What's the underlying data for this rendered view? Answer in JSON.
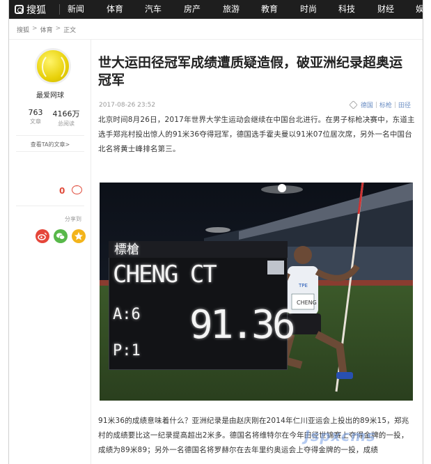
{
  "header": {
    "logo_text": "搜狐",
    "nav": [
      "新闻",
      "体育",
      "汽车",
      "房产",
      "旅游",
      "教育",
      "时尚",
      "科技",
      "财经",
      "娱"
    ]
  },
  "breadcrumb": [
    "搜狐",
    "体育",
    "正文"
  ],
  "author": {
    "name": "最爱网球",
    "articles": "763",
    "articles_label": "文章",
    "reads": "4166万",
    "reads_label": "总阅读",
    "view_link": "查看TA的文章>"
  },
  "engagement": {
    "comment_count": "0",
    "share_label": "分享到"
  },
  "article": {
    "title": "世大运田径冠军成绩遭质疑造假，破亚洲纪录超奥运冠军",
    "date": "2017-08-26 23:52",
    "tags": [
      "德国",
      "标枪",
      "田径"
    ],
    "para1": "北京时间8月26日，2017年世界大学生运动会继续在中国台北进行。在男子标枪决赛中，东道主选手郑兆村投出惊人的91米36夺得冠军，德国选手霍夫曼以91米07位居次席，另外一名中国台北名将黄士峰排名第三。",
    "para2": "91米36的成绩意味着什么？亚洲纪录是由赵庆刚在2014年仁川亚运会上投出的89米15，郑兆村的成绩要比这一纪录提高超出2米多。德国名将维特尔在今年田径世锦赛上夺得金牌的一投，成绩为89米89；另外一名德国名将罗赫尔在去年里约奥运会上夺得金牌的一投，成绩"
  },
  "photo": {
    "scoreboard_header": "標槍",
    "athlete": "CHENG CT",
    "attempt": "A:6",
    "place": "P:1",
    "result": "91.36",
    "bib_text": "TPE",
    "bib_name": "CHENG"
  },
  "watermark": "Jspxcms",
  "colors": {
    "topbar": "#1e1e1e",
    "accent_red": "#e04b3b",
    "tag_blue": "#6c8fc4"
  }
}
